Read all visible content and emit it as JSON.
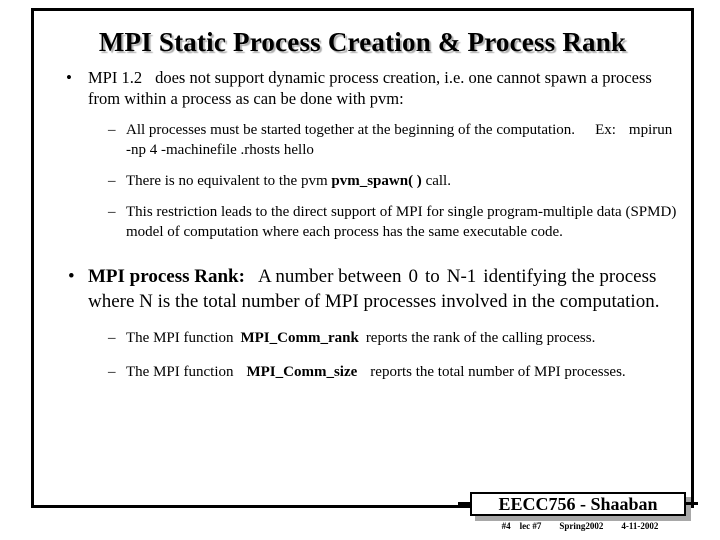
{
  "slide": {
    "title": "MPI Static Process Creation & Process Rank",
    "bullet_marker_l1": "•",
    "bullet_marker_l2": "–",
    "bullets": {
      "b1": {
        "pre": "MPI 1.2",
        "rest": "does not support dynamic process creation, i.e. one cannot spawn a process from within a process as can be done with pvm:"
      },
      "b1_sub1": {
        "line1": "All processes must be started together at the beginning of the computation.",
        "ex_label": "Ex:",
        "command": "mpirun -np 4 -machinefile .rhosts  hello"
      },
      "b1_sub2": {
        "pre": "There is no equivalent to the pvm",
        "bold": "pvm_spawn( )",
        "post": "call."
      },
      "b1_sub3": {
        "text": "This restriction leads to the direct support of MPI for single program-multiple data (SPMD) model of computation where each process has the same executable code."
      },
      "b2": {
        "bold": "MPI process Rank:",
        "pre": "A number between",
        "range_start": "0",
        "range_mid": "to",
        "range_end": "N-1",
        "post": "identifying the process where N is the total number of MPI processes involved in the computation."
      },
      "b2_sub1": {
        "pre": "The MPI function",
        "bold": "MPI_Comm_rank",
        "post": "reports the rank of the calling process."
      },
      "b2_sub2": {
        "pre": "The MPI function",
        "bold": "MPI_Comm_size",
        "post": "reports  the total number of MPI processes."
      }
    },
    "footer": {
      "course_label": "EECC756 - Shaaban",
      "slide_number": "#4",
      "lecture": "lec #7",
      "term": "Spring2002",
      "date": "4-11-2002"
    },
    "colors": {
      "text": "#000000",
      "background": "#ffffff",
      "border": "#000000",
      "shadow": "#a8a8a8"
    }
  }
}
